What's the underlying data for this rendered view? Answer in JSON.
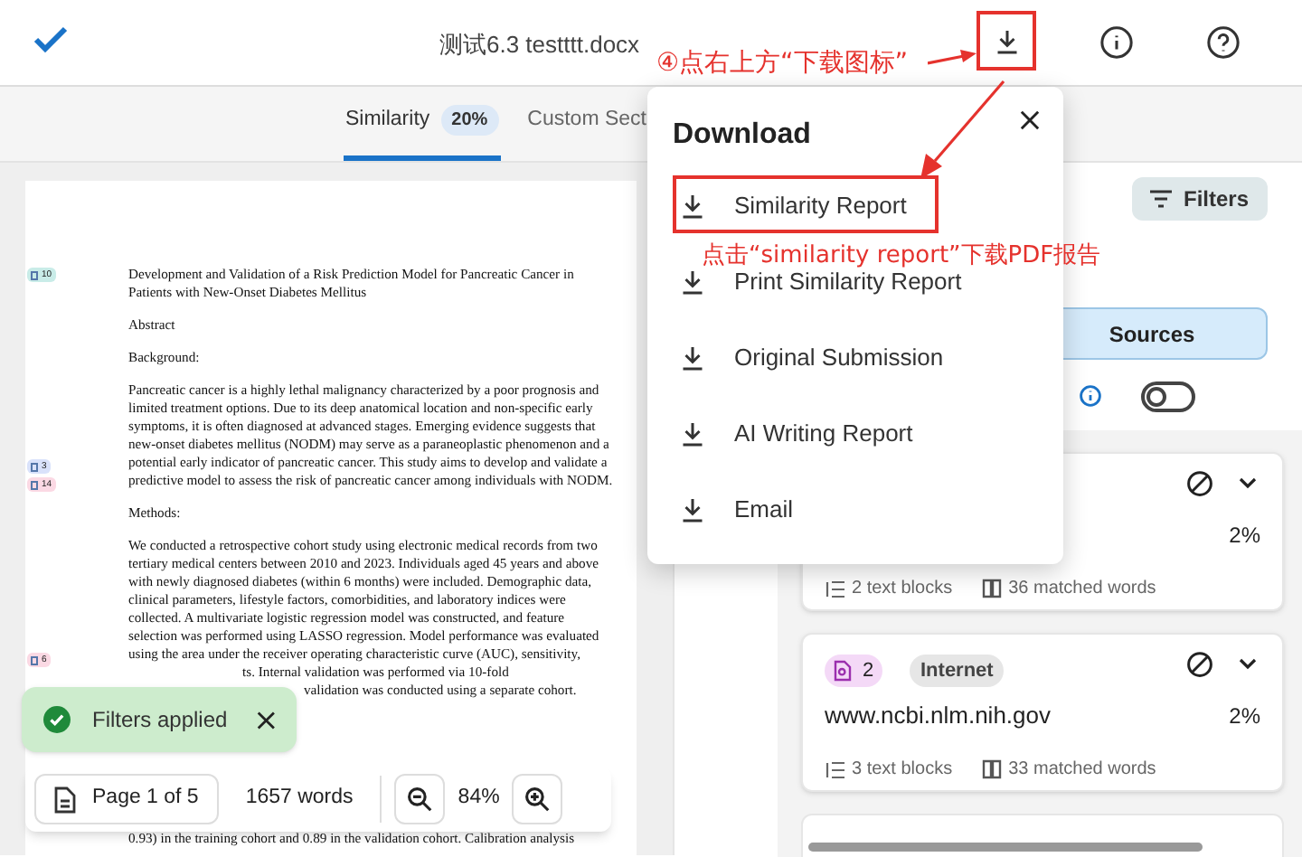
{
  "header": {
    "title": "测试6.3 testttt.docx"
  },
  "tabs": [
    {
      "label": "Similarity",
      "badge": "20%",
      "selected": true
    },
    {
      "label": "Custom Sect",
      "selected": false
    }
  ],
  "document": {
    "markers": [
      {
        "label": "10",
        "color": "#c9ece8"
      },
      {
        "label": "3",
        "color": "#d9e2fb"
      },
      {
        "label": "14",
        "color": "#fbd9e4"
      },
      {
        "label": "6",
        "color": "#fbd9e4"
      }
    ],
    "blocks": [
      {
        "kind": "title",
        "text": "Development and Validation of a Risk Prediction Model for Pancreatic Cancer in Patients with New-Onset Diabetes Mellitus"
      },
      {
        "kind": "heading",
        "text": "Abstract"
      },
      {
        "kind": "heading",
        "text": "Background:"
      },
      {
        "kind": "para",
        "text": "Pancreatic cancer is a highly lethal malignancy characterized by a poor prognosis and limited treatment options. Due to its deep anatomical location and non-specific early symptoms, it is often diagnosed at advanced stages. Emerging evidence suggests that new-onset diabetes mellitus (NODM) may serve as a paraneoplastic phenomenon and a potential early indicator of pancreatic cancer. This study aims to develop and validate a predictive model to assess the risk of pancreatic cancer among individuals with NODM."
      },
      {
        "kind": "heading",
        "text": "Methods:"
      },
      {
        "kind": "para",
        "text": "We conducted a retrospective cohort study using electronic medical records from two tertiary medical centers between 2010 and 2023. Individuals aged 45 years and above with newly diagnosed diabetes (within 6 months) were included. Demographic data, clinical parameters, lifestyle factors, comorbidities, and laboratory indices were collected. A multivariate logistic regression model was constructed, and feature selection was performed using LASSO regression. Model performance was evaluated using the area under the receiver operating characteristic curve (AUC), sensitivity,"
      },
      {
        "kind": "fragment",
        "text": "ts. Internal validation was performed via 10-fold"
      },
      {
        "kind": "fragment",
        "text": "validation was conducted using a separate cohort."
      },
      {
        "kind": "last",
        "text": "0.93) in the training cohort and 0.89 in the validation cohort. Calibration analysis"
      }
    ]
  },
  "toast": {
    "text": "Filters applied"
  },
  "toolbar": {
    "page": "Page 1 of 5",
    "words": "1657 words",
    "zoom": "84%"
  },
  "sidebar": {
    "filters": "Filters",
    "segments": [
      {
        "label": "Sources",
        "selected": true
      }
    ],
    "toggle": {
      "on": false
    },
    "cards": [
      {
        "percent": "2%",
        "text_blocks": "2 text blocks",
        "matched": "36 matched words"
      },
      {
        "number": "2",
        "type": "Internet",
        "source": "www.ncbi.nlm.nih.gov",
        "percent": "2%",
        "text_blocks": "3 text blocks",
        "matched": "33 matched words"
      }
    ]
  },
  "download_menu": {
    "title": "Download",
    "items": [
      {
        "label": "Similarity Report"
      },
      {
        "label": "Print Similarity Report"
      },
      {
        "label": "Original Submission"
      },
      {
        "label": "AI Writing Report"
      },
      {
        "label": "Email"
      }
    ]
  },
  "annotations": [
    {
      "text": "④点右上方“下载图标”"
    },
    {
      "text": "点击“similarity report”下载PDF报告"
    }
  ]
}
